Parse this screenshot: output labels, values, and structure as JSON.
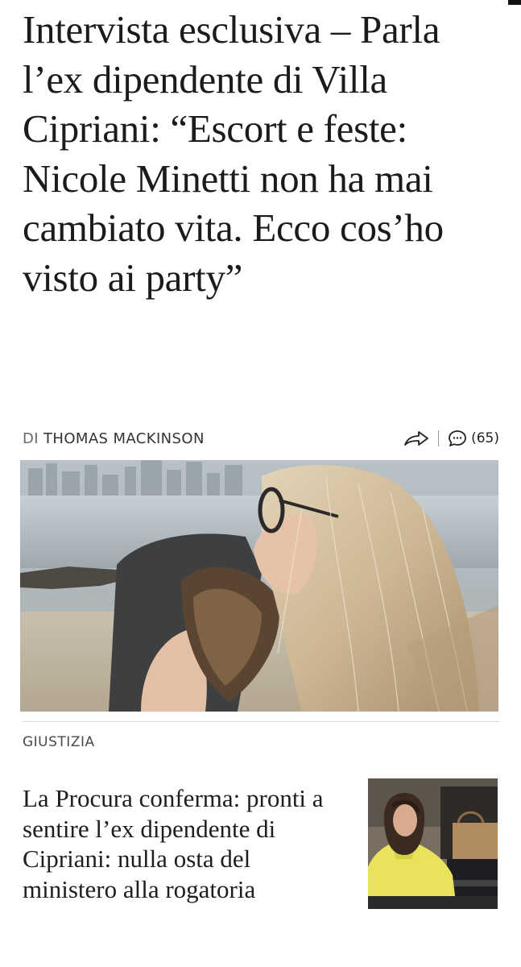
{
  "article": {
    "headline": "Intervista esclusiva – Parla l’ex dipendente di Villa Cipriani: “Escort e feste: Nicole Minetti non ha mai cambiato vita. Ecco cos’ho visto ai party”",
    "byline_prefix": "DI",
    "author": "THOMAS MACKINSON",
    "comment_count": "(65)",
    "icons": {
      "share": "share-arrow-icon",
      "comments": "comment-bubble-icon"
    }
  },
  "related": {
    "section_label": "GIUSTIZIA",
    "title": "La Procura conferma: pronti a sentire l’ex dipendente di Cipriani: nulla osta del ministero alla rogatoria"
  },
  "colors": {
    "text": "#1b1b1b",
    "meta": "#4a4a4a",
    "divider": "#d9d9d9",
    "background": "#ffffff"
  }
}
